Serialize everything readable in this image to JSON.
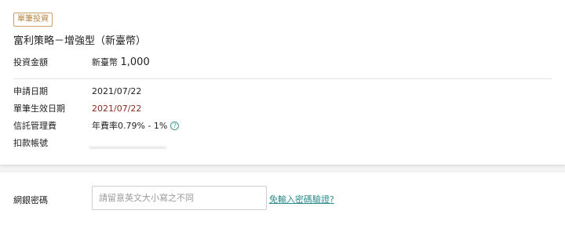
{
  "badge": "單筆投資",
  "product_name": "富利策略－增強型（新臺幣）",
  "investment": {
    "label": "投資金額",
    "currency": "新臺幣",
    "amount": "1,000"
  },
  "details": {
    "apply_date_label": "申請日期",
    "apply_date_value": "2021/07/22",
    "effective_date_label": "單筆生效日期",
    "effective_date_value": "2021/07/22",
    "fee_label": "信託管理費",
    "fee_value": "年費率0.79% - 1%",
    "account_label": "扣款帳號"
  },
  "password": {
    "label": "網銀密碼",
    "placeholder": "請留意英文大小寫之不同",
    "value": "",
    "link_text": "免輸入密碼驗證?"
  },
  "colors": {
    "accent_badge": "#c8a063",
    "effective_date": "#8a2a1d",
    "link": "#2e8c8c"
  }
}
